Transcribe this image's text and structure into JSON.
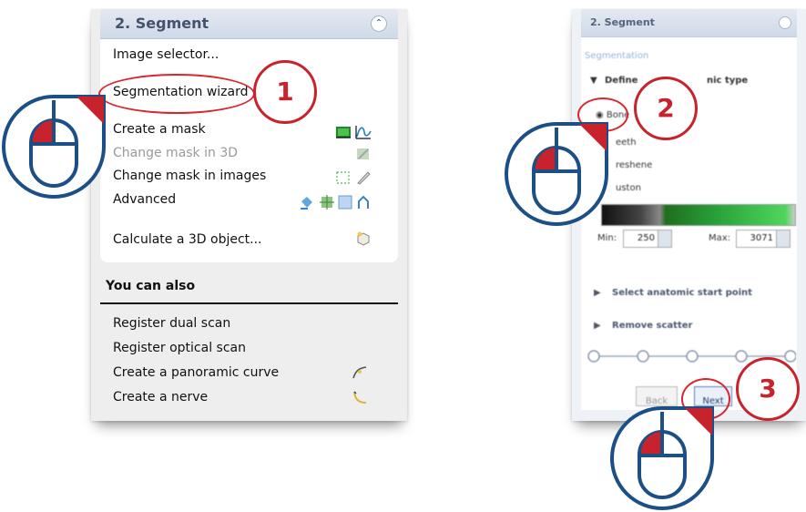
{
  "left": {
    "header_title": "2. Segment",
    "menu": [
      {
        "label": "Image selector..."
      },
      {
        "label": "Segmentation wizard"
      },
      {
        "label": "Create a mask"
      },
      {
        "label": "Change mask in 3D"
      },
      {
        "label": "Change mask in images"
      },
      {
        "label": "Advanced"
      },
      {
        "label": "Calculate a 3D object..."
      }
    ],
    "you_can_also": "You can also",
    "also_items": [
      {
        "label": "Register dual scan"
      },
      {
        "label": "Register optical scan"
      },
      {
        "label": "Create a panoramic curve"
      },
      {
        "label": "Create a nerve"
      }
    ]
  },
  "right": {
    "header_title": "2. Segment",
    "section_label": "Segmentation",
    "define_label": "Define",
    "define_suffix": "nic type",
    "options": [
      "Bone",
      "eeth",
      "reshene",
      "uston"
    ],
    "min_label": "Min:",
    "min_value": "250",
    "max_label": "Max:",
    "max_value": "3071",
    "select_start": "Select anatomic start point",
    "remove_scatter": "Remove scatter",
    "back_label": "Back",
    "next_label": "Next"
  },
  "callouts": [
    "1",
    "2",
    "3"
  ],
  "colors": {
    "accent_red": "#c8232c",
    "mouse_blue": "#1b4f86",
    "header_blue": "#cfd9e8"
  }
}
